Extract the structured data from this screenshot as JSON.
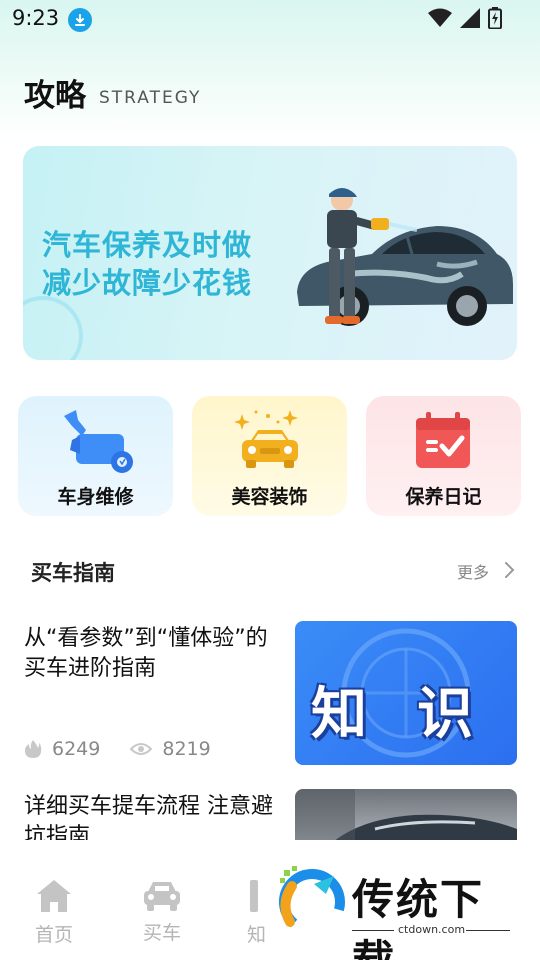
{
  "status_bar": {
    "time": "9:23"
  },
  "header": {
    "title": "攻略",
    "subtitle": "STRATEGY"
  },
  "banner": {
    "line1": "汽车保养及时做",
    "line2": "减少故障少花钱"
  },
  "categories": [
    {
      "label": "车身维修",
      "icon": "wrench-car-icon"
    },
    {
      "label": "美容装饰",
      "icon": "sparkle-car-icon"
    },
    {
      "label": "保养日记",
      "icon": "calendar-check-icon"
    }
  ],
  "section": {
    "title": "买车指南",
    "more": "更多"
  },
  "articles": [
    {
      "title": "从“看参数”到“懂体验”的买车进阶指南",
      "hot_count": "6249",
      "view_count": "8219",
      "thumb_text_1": "知",
      "thumb_text_2": "识"
    },
    {
      "title": "详细买车提车流程 注意避坑指南"
    }
  ],
  "bottom_nav": [
    {
      "label": "首页",
      "icon": "home-icon"
    },
    {
      "label": "买车",
      "icon": "car-icon"
    },
    {
      "label": "知",
      "icon": "knowledge-icon"
    }
  ],
  "watermark": {
    "name": "传统下载",
    "url": "ctdown.com"
  },
  "colors": {
    "banner_text": "#2fb6d6",
    "accent_blue": "#2c6ff0",
    "nav_inactive": "#b5b5b5"
  }
}
